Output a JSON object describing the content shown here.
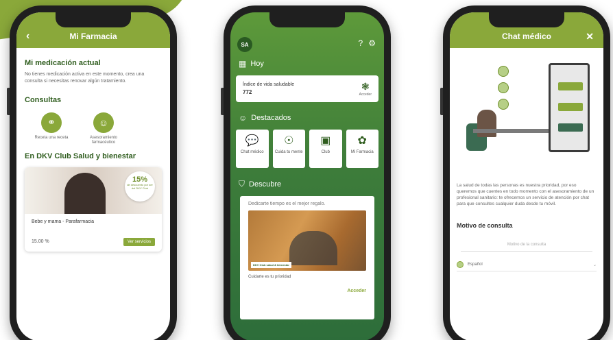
{
  "phone1": {
    "title": "Mi Farmacia",
    "back_icon": "chevron-left-icon",
    "heading_medication": "Mi medicación actual",
    "medication_text": "No tienes medicación activa en este momento, crea una consulta si necesitas renovar algún tratamiento.",
    "heading_consultas": "Consultas",
    "consults": [
      {
        "label": "Receta una receta",
        "icon": "pills-icon"
      },
      {
        "label": "Asesoramiento farmacéutico",
        "icon": "pharmacist-icon"
      }
    ],
    "heading_club": "En DKV Club Salud y bienestar",
    "promo": {
      "badge_pct": "15%",
      "badge_sub": "de descuento por ser del DKV Club",
      "title": "Bebe y mama - Parafarmacia",
      "price": "15.00 %",
      "button": "Ver servicios"
    }
  },
  "phone2": {
    "avatar": "SA",
    "section_today": "Hoy",
    "index_label": "Índice de vida saludable",
    "index_value": "772",
    "index_action": "Acceder",
    "section_featured": "Destacados",
    "tiles": [
      {
        "label": "Chat médico",
        "icon": "chat-icon"
      },
      {
        "label": "Cuida tu mente",
        "icon": "brain-icon"
      },
      {
        "label": "Club",
        "icon": "card-icon"
      },
      {
        "label": "Mi Farmacia",
        "icon": "flower-icon"
      }
    ],
    "section_discover": "Descubre",
    "discover_title": "Dedicarte tiempo es el mejor regalo.",
    "discover_logo": "DKV Club salud & bienestar",
    "discover_caption": "Cuidarte es tu prioridad",
    "discover_button": "Acceder"
  },
  "phone3": {
    "title": "Chat médico",
    "close_icon": "close-icon",
    "intro_text": "La salud de todas las personas es nuestra prioridad, por eso queremos que cuentes en todo momento con el asesoramiento de un profesional sanitario: te ofrecemos un servicio de atención por chat para que consultes cualquier duda desde tu móvil.",
    "motivo_heading": "Motivo de consulta",
    "motivo_placeholder": "Motivo de la consulta",
    "language": "Español"
  },
  "colors": {
    "brand_green": "#8aa83a",
    "dark_green": "#2f5d1e"
  }
}
